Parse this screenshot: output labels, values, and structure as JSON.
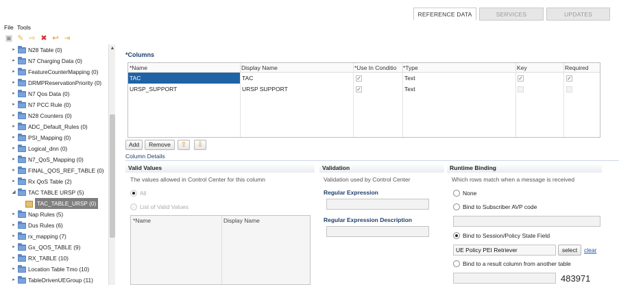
{
  "top_tabs": [
    "REFERENCE DATA",
    "SERVICES",
    "UPDATES"
  ],
  "menu": {
    "file": "File",
    "tools": "Tools"
  },
  "toolbar": {
    "save_icon": "save-icon",
    "edit_icon": "pencil-icon",
    "move_icon": "move-icon",
    "delete_icon": "delete-icon",
    "undo_icon": "undo-icon",
    "redo_icon": "redo-icon"
  },
  "tree": {
    "items": [
      "N28 Table (0)",
      "N7 Charging Data (0)",
      "FeatureCounterMapping (0)",
      "DRMPReservationPriority (0)",
      "N7 Qos Data (0)",
      "N7 PCC Rule (0)",
      "N28 Counters (0)",
      "ADC_Default_Rules (0)",
      "PSI_Mapping (0)",
      "Logical_dnn (0)",
      "N7_QoS_Mapping (0)",
      "FINAL_QOS_REF_TABLE (0)",
      "Rx QoS Table (2)",
      "TAC TABLE URSP (5)",
      "TAC_TABLE_URSP (0)",
      "Nap Rules (5)",
      "Dus Rules (6)",
      "rx_mapping (7)",
      "Gx_QOS_TABLE (9)",
      "RX_TABLE (10)",
      "Location Table Tmo (10)",
      "TableDrivenUEGroup (11)"
    ]
  },
  "columns": {
    "title": "*Columns",
    "headers": [
      "*Name",
      "Display Name",
      "*Use In Conditio",
      "*Type",
      "Key",
      "Required"
    ],
    "rows": [
      {
        "name": "TAC",
        "display": "TAC",
        "use": "✓",
        "type": "Text",
        "key": "✓",
        "required": "✓"
      },
      {
        "name": "URSP_SUPPORT",
        "display": "URSP SUPPORT",
        "use": "✓",
        "type": "Text",
        "key": "",
        "required": ""
      }
    ],
    "buttons": {
      "add": "Add",
      "remove": "Remove",
      "up_icon": "arrow-up-icon",
      "down_icon": "arrow-down-icon"
    }
  },
  "details": {
    "title": "Column Details",
    "valid_values": {
      "header": "Valid Values",
      "desc": "The values allowed in Control Center for this column",
      "opt_all": "All",
      "opt_list": "List of Valid Values",
      "table_headers": [
        "*Name",
        "Display Name"
      ]
    },
    "validation": {
      "header": "Validation",
      "desc": "Validation used by Control Center",
      "regex_label": "Regular Expression",
      "regex_value": "",
      "regex_desc_label": "Regular Expression Description",
      "regex_desc_value": ""
    },
    "runtime": {
      "header": "Runtime Binding",
      "desc": "Which rows match when a message is received",
      "opt_none": "None",
      "opt_avp": "Bind to Subscriber AVP code",
      "avp_value": "",
      "opt_state": "Bind to Session/Policy State Field",
      "state_value": "UE Policy PEI Retriever",
      "select_btn": "select",
      "clear_link": "clear",
      "opt_result": "Bind to a result column from another table",
      "result_value": "483971"
    }
  }
}
